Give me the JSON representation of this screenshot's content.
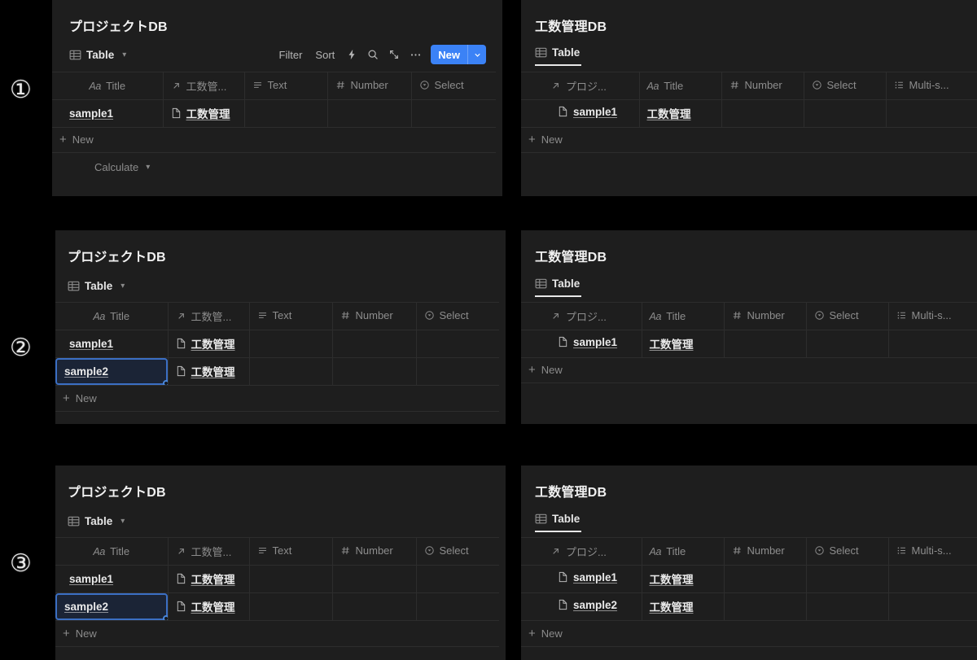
{
  "markers": {
    "one": "①",
    "two": "②",
    "three": "③"
  },
  "colors": {
    "accent_blue": "#3b82f6",
    "selection_border": "#3b6fc4",
    "selection_fill": "#1b2436",
    "panel_bg": "#1e1e1e",
    "page_bg": "#000000",
    "grid_line": "#2d2d2d"
  },
  "left_db": {
    "title": "プロジェクトDB",
    "view_tab": "Table",
    "toolbar": {
      "filter": "Filter",
      "sort": "Sort",
      "automation_icon": "lightning-icon",
      "search_icon": "search-icon",
      "expand_icon": "expand-icon",
      "more_icon": "ellipsis-icon",
      "new_label": "New",
      "new_dropdown_icon": "chevron-down-icon"
    },
    "columns": [
      {
        "label": "Title",
        "icon": "aa-text-icon",
        "type": "title"
      },
      {
        "label": "工数管...",
        "icon": "relation-arrow-icon",
        "type": "relation"
      },
      {
        "label": "Text",
        "icon": "text-lines-icon",
        "type": "text"
      },
      {
        "label": "Number",
        "icon": "hash-icon",
        "type": "number"
      },
      {
        "label": "Select",
        "icon": "select-circle-icon",
        "type": "select"
      }
    ],
    "rows_state1": [
      {
        "title": "sample1",
        "relation": "工数管理",
        "text": "",
        "number": "",
        "select": "",
        "selected": false
      }
    ],
    "rows_state2": [
      {
        "title": "sample1",
        "relation": "工数管理",
        "text": "",
        "number": "",
        "select": "",
        "selected": false
      },
      {
        "title": "sample2",
        "relation": "工数管理",
        "text": "",
        "number": "",
        "select": "",
        "selected": true
      }
    ],
    "new_row_label": "New",
    "calculate_label": "Calculate"
  },
  "right_db": {
    "title": "工数管理DB",
    "view_tab": "Table",
    "columns": [
      {
        "label": "プロジ...",
        "icon": "relation-arrow-icon",
        "type": "relation"
      },
      {
        "label": "Title",
        "icon": "aa-text-icon",
        "type": "title"
      },
      {
        "label": "Number",
        "icon": "hash-icon",
        "type": "number"
      },
      {
        "label": "Select",
        "icon": "select-circle-icon",
        "type": "select"
      },
      {
        "label": "Multi-s...",
        "icon": "multi-select-icon",
        "type": "multi-select"
      }
    ],
    "rows_state1": [
      {
        "relation": "sample1",
        "title": "工数管理",
        "number": "",
        "select": "",
        "multi": ""
      }
    ],
    "rows_state3": [
      {
        "relation": "sample1",
        "title": "工数管理",
        "number": "",
        "select": "",
        "multi": ""
      },
      {
        "relation": "sample2",
        "title": "工数管理",
        "number": "",
        "select": "",
        "multi": ""
      }
    ],
    "new_row_label": "New"
  }
}
